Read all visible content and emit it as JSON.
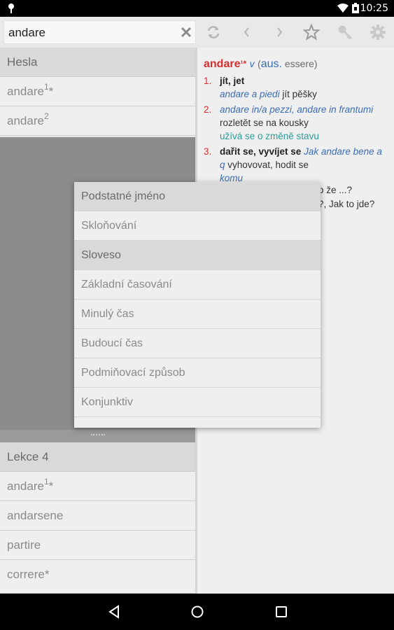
{
  "status": {
    "time": "10:25"
  },
  "search": {
    "value": "andare",
    "placeholder": ""
  },
  "left": {
    "header1": "Hesla",
    "results": [
      {
        "word": "andare",
        "sup": "1",
        "mark": "*"
      },
      {
        "word": "andare",
        "sup": "2",
        "mark": ""
      }
    ],
    "header2": "Lekce 4",
    "lesson_items": [
      {
        "word": "andare",
        "sup": "1",
        "mark": "*"
      },
      {
        "word": "andarsene",
        "sup": "",
        "mark": ""
      },
      {
        "word": "partire",
        "sup": "",
        "mark": ""
      },
      {
        "word": "correre*",
        "sup": "",
        "mark": ""
      }
    ]
  },
  "entry": {
    "headword": "andare",
    "headword_mark": "¹*",
    "pos": "v",
    "aux_open": "(",
    "aux_label": "aus.",
    "aux_value": " essere)",
    "senses": [
      {
        "num": "1.",
        "def": "jít, jet",
        "example": "andare a piedi",
        "translation": " jít pěšky",
        "note": ""
      },
      {
        "num": "2.",
        "def": "",
        "example": "andare in/a pezzi, andare in frantumi",
        "translation": " rozletět se na kousky",
        "note": "užívá se o změně stavu"
      },
      {
        "num": "3.",
        "def": "dařit se, vyvíjet se",
        "example": " Jak andare bene a q",
        "translation": " vyhovovat, hodit se",
        "note": "",
        "extra": "komu"
      }
    ],
    "partial_lines": [
      "o že ...?",
      "?, Jak to jde?"
    ]
  },
  "menu": {
    "items": [
      {
        "label": "Podstatné jméno",
        "selected": true
      },
      {
        "label": "Skloňování",
        "selected": false
      },
      {
        "label": "Sloveso",
        "selected": true
      },
      {
        "label": "Základní časování",
        "selected": false
      },
      {
        "label": "Minulý čas",
        "selected": false
      },
      {
        "label": "Budoucí čas",
        "selected": false
      },
      {
        "label": "Podmiňovací způsob",
        "selected": false
      },
      {
        "label": "Konjunktiv",
        "selected": false
      }
    ]
  },
  "icons": {
    "status_left": "notification-pin-icon",
    "wifi": "wifi-icon",
    "battery": "battery-icon",
    "clear": "close-icon",
    "swap": "swap-icon",
    "back": "chevron-left-icon",
    "forward": "chevron-right-icon",
    "star": "star-icon",
    "key": "key-icon",
    "settings": "gear-icon"
  },
  "colors": {
    "accent": "#d32f2f",
    "link": "#3b6db3",
    "note": "#2a9d9a"
  }
}
